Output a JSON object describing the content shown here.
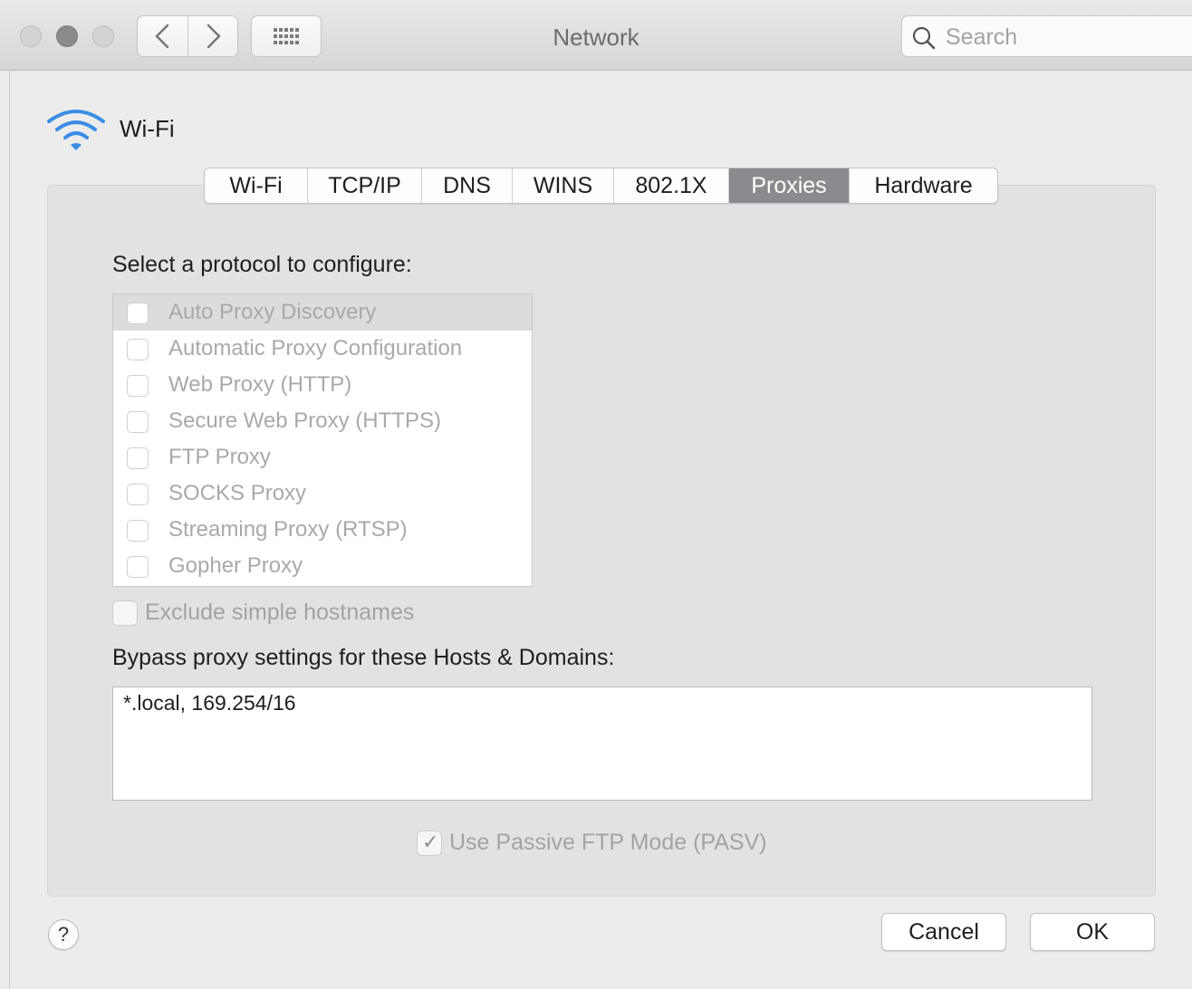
{
  "window": {
    "title": "Network",
    "search_placeholder": "Search"
  },
  "interface": {
    "name": "Wi-Fi",
    "icon": "wifi-icon"
  },
  "tabs": [
    {
      "label": "Wi-Fi",
      "active": false
    },
    {
      "label": "TCP/IP",
      "active": false
    },
    {
      "label": "DNS",
      "active": false
    },
    {
      "label": "WINS",
      "active": false
    },
    {
      "label": "802.1X",
      "active": false
    },
    {
      "label": "Proxies",
      "active": true
    },
    {
      "label": "Hardware",
      "active": false
    }
  ],
  "proxies": {
    "select_label": "Select a protocol to configure:",
    "protocols": [
      {
        "label": "Auto Proxy Discovery",
        "checked": false,
        "selected": true
      },
      {
        "label": "Automatic Proxy Configuration",
        "checked": false,
        "selected": false
      },
      {
        "label": "Web Proxy (HTTP)",
        "checked": false,
        "selected": false
      },
      {
        "label": "Secure Web Proxy (HTTPS)",
        "checked": false,
        "selected": false
      },
      {
        "label": "FTP Proxy",
        "checked": false,
        "selected": false
      },
      {
        "label": "SOCKS Proxy",
        "checked": false,
        "selected": false
      },
      {
        "label": "Streaming Proxy (RTSP)",
        "checked": false,
        "selected": false
      },
      {
        "label": "Gopher Proxy",
        "checked": false,
        "selected": false
      }
    ],
    "exclude_simple_hostnames": {
      "label": "Exclude simple hostnames",
      "checked": false
    },
    "bypass_label": "Bypass proxy settings for these Hosts & Domains:",
    "bypass_value": "*.local, 169.254/16",
    "passive_ftp": {
      "label": "Use Passive FTP Mode (PASV)",
      "checked": true
    }
  },
  "footer": {
    "help_label": "?",
    "cancel_label": "Cancel",
    "ok_label": "OK"
  }
}
